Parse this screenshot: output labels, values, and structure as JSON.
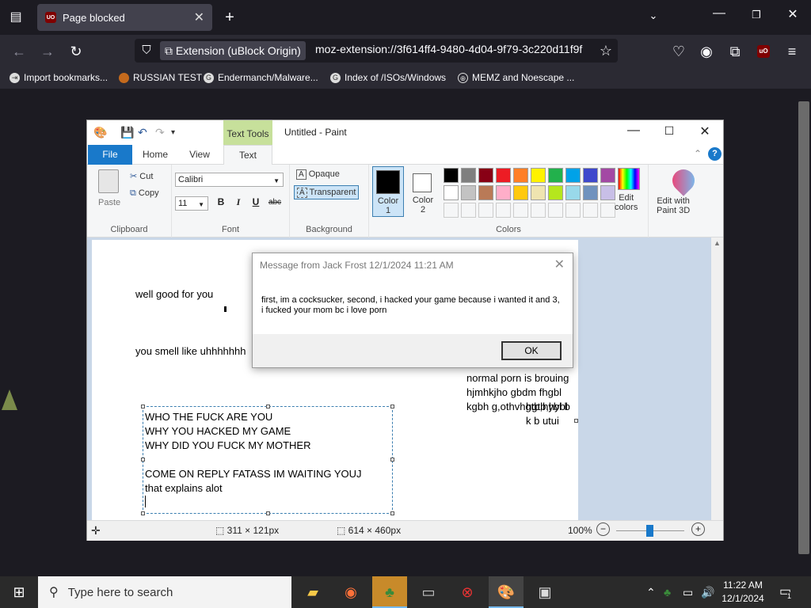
{
  "browser": {
    "tab_title": "Page blocked",
    "tab_favicon": "UO",
    "ext_label": "Extension (uBlock Origin)",
    "url": "moz-extension://3f614ff4-9480-4d04-9f79-3c220d11f9f",
    "bookmarks": [
      {
        "label": "Import bookmarks..."
      },
      {
        "label": "RUSSIAN TEST"
      },
      {
        "label": "Endermanch/Malware..."
      },
      {
        "label": "Index of /ISOs/Windows"
      },
      {
        "label": "MEMZ and Noescape ..."
      }
    ]
  },
  "paint": {
    "title": "Untitled - Paint",
    "context_tab": "Text Tools",
    "tabs": {
      "file": "File",
      "home": "Home",
      "view": "View",
      "text": "Text"
    },
    "clipboard": {
      "paste": "Paste",
      "cut": "Cut",
      "copy": "Copy",
      "label": "Clipboard"
    },
    "font": {
      "family": "Calibri",
      "size": "11",
      "bold": "B",
      "italic": "I",
      "underline": "U",
      "strike": "abc",
      "label": "Font"
    },
    "background": {
      "opaque": "Opaque",
      "transparent": "Transparent",
      "label": "Background"
    },
    "colors": {
      "color1": "Color\n1",
      "color1_a": "Color",
      "color1_b": "1",
      "color2_a": "Color",
      "color2_b": "2",
      "edit_colors_a": "Edit",
      "edit_colors_b": "colors",
      "paint3d_a": "Edit with",
      "paint3d_b": "Paint 3D",
      "label": "Colors",
      "row1": [
        "#000000",
        "#7f7f7f",
        "#880015",
        "#ed1c24",
        "#ff7f27",
        "#fff200",
        "#22b14c",
        "#00a2e8",
        "#3f48cc",
        "#a349a4"
      ],
      "row2": [
        "#ffffff",
        "#c3c3c3",
        "#b97a57",
        "#ffaec9",
        "#ffc90e",
        "#efe4b0",
        "#b5e61d",
        "#99d9ea",
        "#7092be",
        "#c8bfe7"
      ]
    },
    "canvas": {
      "text1": "well good for you",
      "text2": "you smell like uhhhhhhh",
      "right_lines": [
        "normal porn is brouing",
        "hjmhkjho gbdm fhgbl",
        "kgbh g,othvhgtb,hybl b"
      ],
      "right_lines2": [
        "hgtb,hybl",
        "k b   utui"
      ],
      "box_lines": [
        "WHO THE FUCK ARE YOU",
        "WHY YOU HACKED MY GAME",
        "WHY DID YOU FUCK MY MOTHER",
        "",
        "COME ON REPLY FATASS IM WAITING YOUJ",
        "that explains alot"
      ]
    },
    "status": {
      "selection": "311 × 121px",
      "canvas_size": "614 × 460px",
      "zoom": "100%"
    }
  },
  "dialog": {
    "title": "Message from Jack Frost 12/1/2024 11:21 AM",
    "message": "first, im a cocksucker, second, i hacked your game because i wanted it and 3, i fucked your mom bc i love porn",
    "ok": "OK"
  },
  "taskbar": {
    "search_placeholder": "Type here to search",
    "time": "11:22 AM",
    "date": "12/1/2024",
    "notif_count": "1"
  }
}
